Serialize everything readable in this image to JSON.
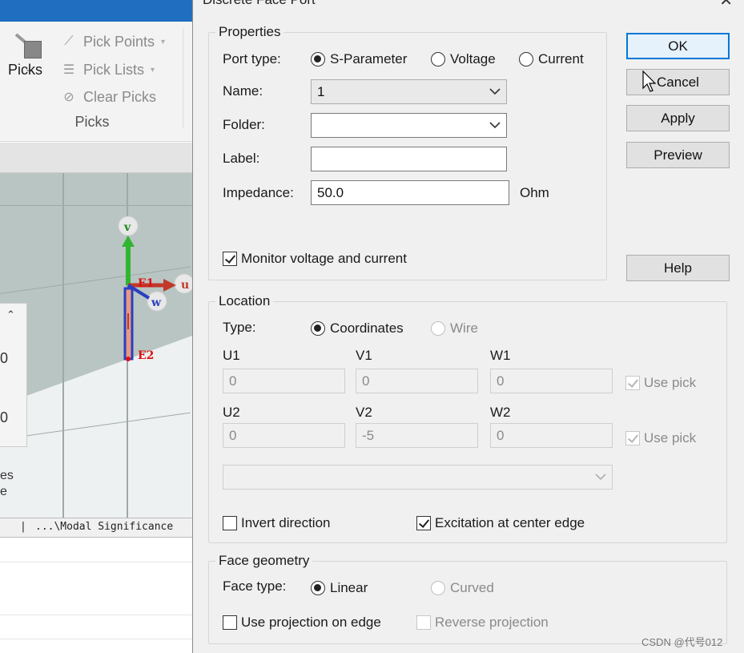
{
  "ribbon": {
    "picks_big_label": "Picks",
    "pick_points": "Pick Points",
    "pick_lists": "Pick Lists",
    "clear_picks": "Clear Picks",
    "group_label": "Picks"
  },
  "viewport": {
    "axis_v": "v",
    "axis_u": "u",
    "axis_w": "w",
    "edge_e1": "E1",
    "edge_e2": "E2",
    "panel_value_1": "0",
    "panel_value_2": "0",
    "side_text_1": "es",
    "side_text_2": "e"
  },
  "statusbar": {
    "text": "...\\Modal Significance"
  },
  "dialog": {
    "title": "Discrete Face Port",
    "close": "✕",
    "properties": {
      "legend": "Properties",
      "port_type_label": "Port type:",
      "port_types": [
        "S-Parameter",
        "Voltage",
        "Current"
      ],
      "name_label": "Name:",
      "name_value": "1",
      "folder_label": "Folder:",
      "folder_value": "",
      "label_label": "Label:",
      "label_value": "",
      "impedance_label": "Impedance:",
      "impedance_value": "50.0",
      "impedance_unit": "Ohm",
      "monitor_label": "Monitor voltage and current"
    },
    "location": {
      "legend": "Location",
      "type_label": "Type:",
      "type_options": [
        "Coordinates",
        "Wire"
      ],
      "u1_label": "U1",
      "v1_label": "V1",
      "w1_label": "W1",
      "u1": "0",
      "v1": "0",
      "w1": "0",
      "u2_label": "U2",
      "v2_label": "V2",
      "w2_label": "W2",
      "u2": "0",
      "v2": "-5",
      "w2": "0",
      "use_pick_label": "Use pick",
      "invert_label": "Invert direction",
      "excitation_label": "Excitation at center edge"
    },
    "face_geometry": {
      "legend": "Face geometry",
      "face_type_label": "Face type:",
      "face_types": [
        "Linear",
        "Curved"
      ],
      "projection_label": "Use projection on edge",
      "reverse_label": "Reverse projection"
    },
    "buttons": {
      "ok": "OK",
      "cancel": "Cancel",
      "apply": "Apply",
      "preview": "Preview",
      "help": "Help"
    }
  },
  "watermark": "CSDN @代号012"
}
